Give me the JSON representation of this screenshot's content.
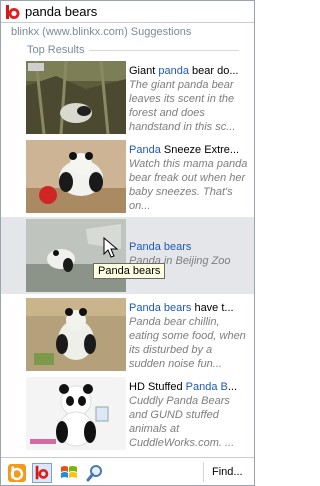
{
  "search": {
    "query": "panda bears"
  },
  "provider_label": "blinkx (www.blinkx.com) Suggestions",
  "section_label": "Top Results",
  "results": [
    {
      "title_pre": "Giant ",
      "title_hl": "panda",
      "title_post": " bear do...",
      "description": "The giant panda bear leaves its scent in the forest and does handstand in this sc..."
    },
    {
      "title_pre": "",
      "title_hl": "Panda",
      "title_post": " Sneeze Extre...",
      "description": "Watch this mama panda bear freak out when her baby sneezes. That's on..."
    },
    {
      "title_pre": "",
      "title_hl": "Panda bears",
      "title_post": "",
      "description": "Panda in Beijing Zoo"
    },
    {
      "title_pre": "",
      "title_hl": "Panda bears",
      "title_post": " have t...",
      "description": "Panda bear chillin, eating some food, when its disturbed by a sudden noise fun..."
    },
    {
      "title_pre": "HD Stuffed ",
      "title_hl": "Panda B",
      "title_post": "...",
      "description": "Cuddly Panda Bears and GUND stuffed animals at CuddleWorks.com. ..."
    }
  ],
  "tooltip": "Panda bears",
  "find_label": "Find...",
  "colors": {
    "highlight": "#1f58b8",
    "hover_row": "#e5e6ea",
    "brand": "#e02020"
  }
}
